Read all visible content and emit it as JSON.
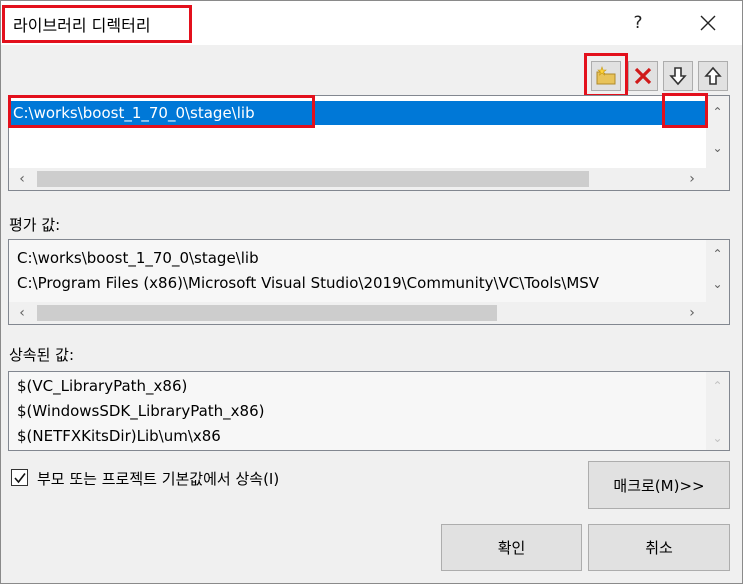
{
  "dialog": {
    "title": "라이브러리 디렉터리",
    "help": "?"
  },
  "toolbar": {
    "new_line": "new-folder-icon",
    "delete": "delete-icon",
    "move_down": "move-down-icon",
    "move_up": "move-up-icon"
  },
  "editor": {
    "items": [
      "C:\\works\\boost_1_70_0\\stage\\lib"
    ]
  },
  "evaluated": {
    "label": "평가 값:",
    "lines": [
      "C:\\works\\boost_1_70_0\\stage\\lib",
      "C:\\Program Files (x86)\\Microsoft Visual Studio\\2019\\Community\\VC\\Tools\\MSV"
    ]
  },
  "inherited": {
    "label": "상속된 값:",
    "lines": [
      "$(VC_LibraryPath_x86)",
      "$(WindowsSDK_LibraryPath_x86)",
      "$(NETFXKitsDir)Lib\\um\\x86"
    ]
  },
  "inherit_checkbox": {
    "label": "부모 또는 프로젝트 기본값에서 상속(I)",
    "checked": true
  },
  "buttons": {
    "macros": "매크로(M)>>",
    "ok": "확인",
    "cancel": "취소"
  },
  "colors": {
    "selection": "#0078d7",
    "highlight_box": "#e3101c"
  }
}
